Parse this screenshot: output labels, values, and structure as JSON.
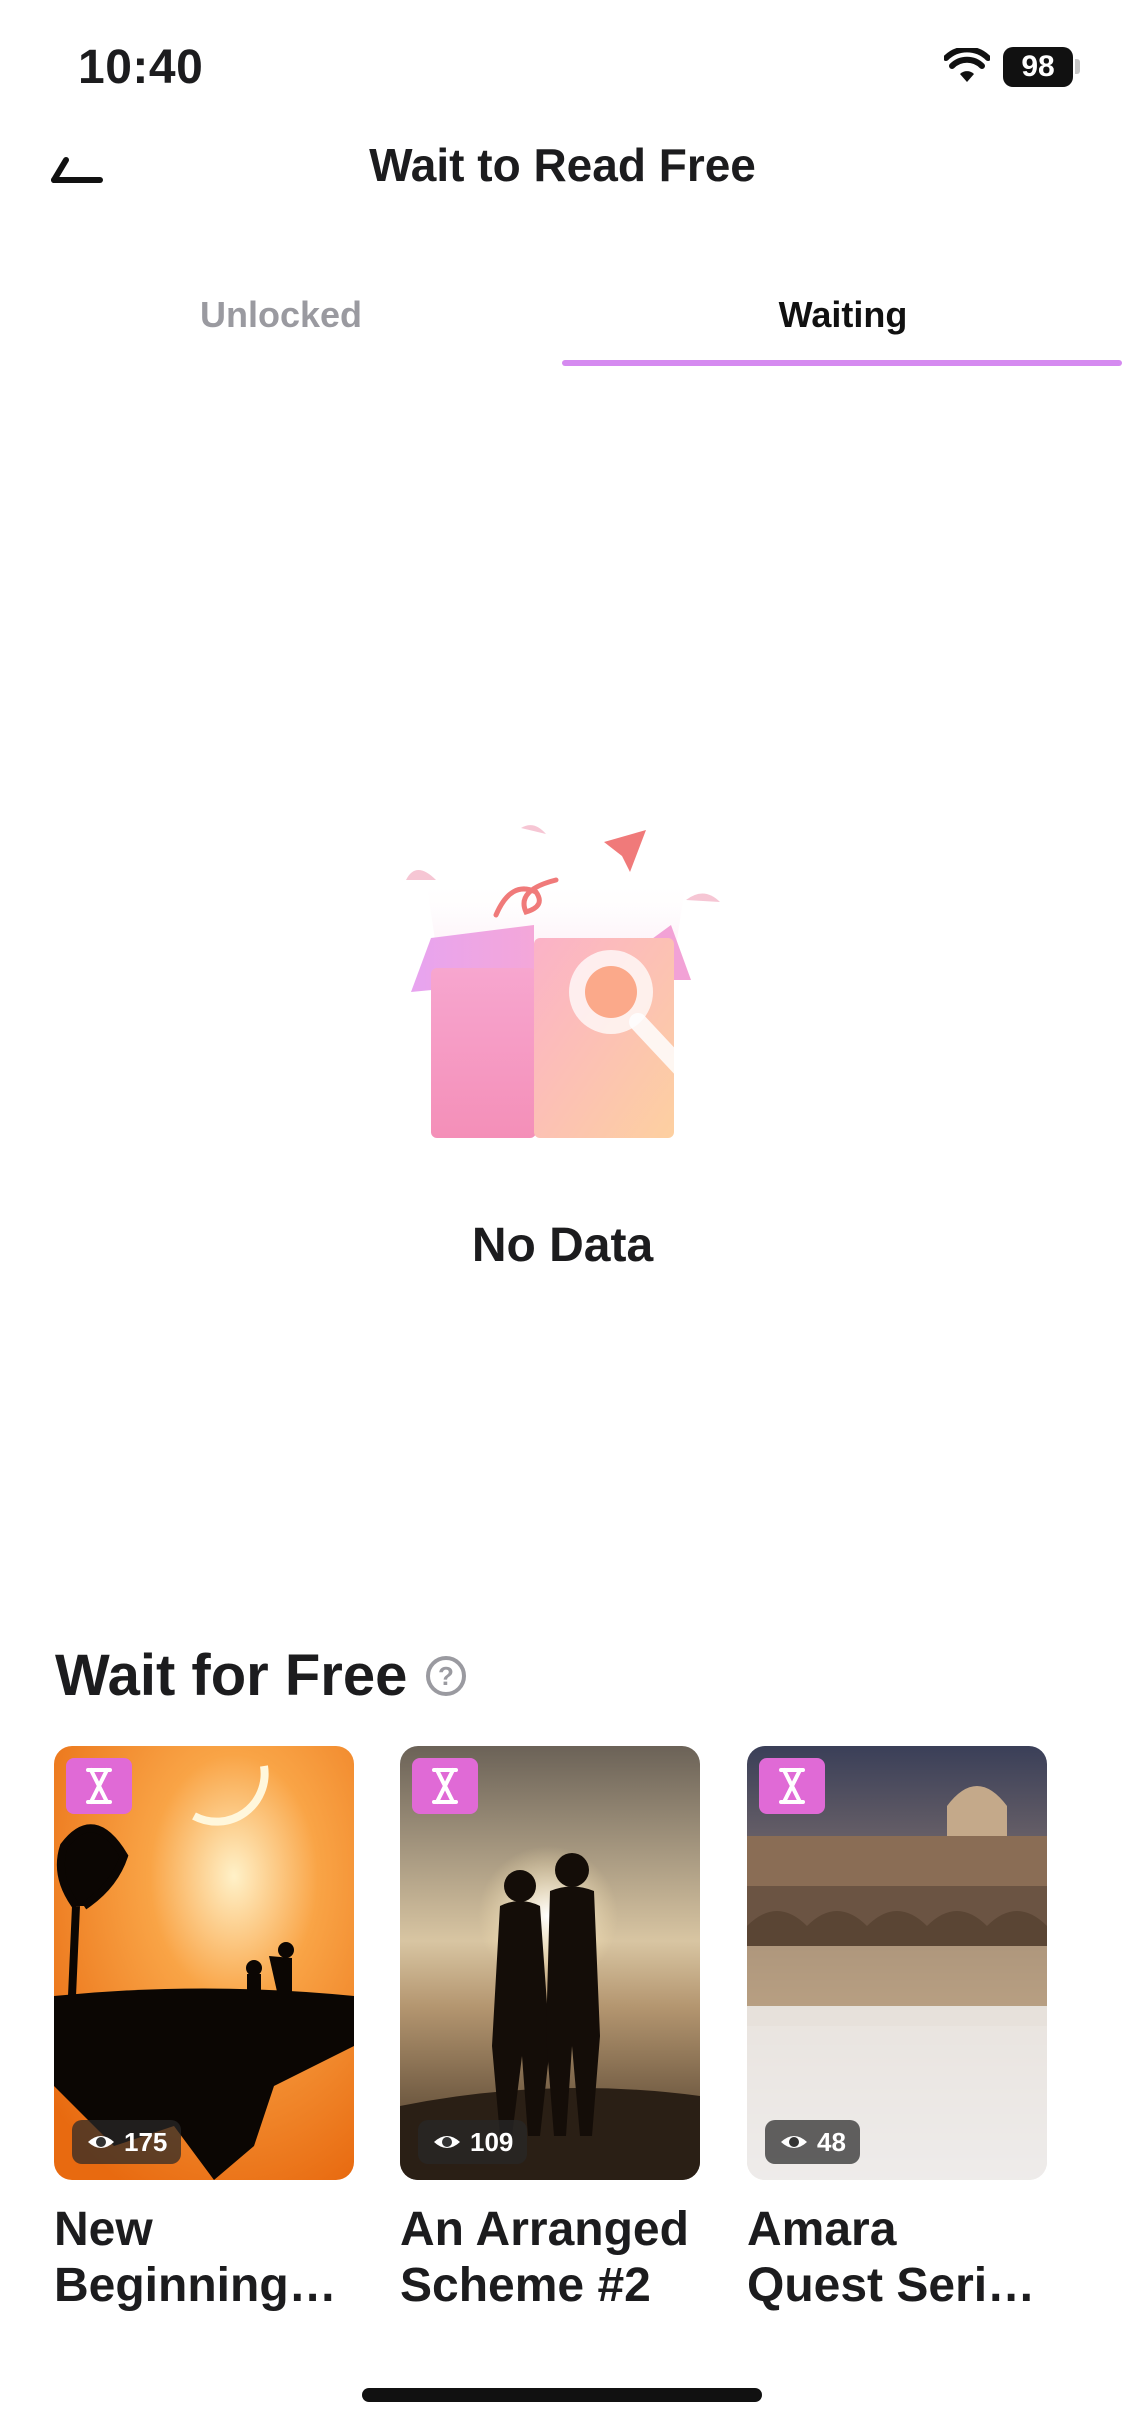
{
  "status_bar": {
    "time": "10:40",
    "battery": "98"
  },
  "header": {
    "title": "Wait to Read Free",
    "back_icon": "back-arrow-icon"
  },
  "tabs": [
    {
      "label": "Unlocked",
      "active": false
    },
    {
      "label": "Waiting",
      "active": true
    }
  ],
  "empty_state": {
    "message": "No Data",
    "icon": "empty-box-search-icon"
  },
  "section": {
    "title": "Wait for Free",
    "help_symbol": "?",
    "books": [
      {
        "title_line1": "New",
        "title_line2": "Beginning…",
        "views": "175",
        "badge_icon": "hourglass-icon"
      },
      {
        "title_line1": "An Arranged",
        "title_line2": "Scheme #2",
        "views": "109",
        "badge_icon": "hourglass-icon"
      },
      {
        "title_line1": "Amara",
        "title_line2": "Quest Seri…",
        "views": "48",
        "badge_icon": "hourglass-icon"
      }
    ]
  },
  "colors": {
    "accent": "#d58af0",
    "badge": "#e06ad6",
    "text": "#1c1c1e",
    "muted": "#9a9aa0"
  }
}
